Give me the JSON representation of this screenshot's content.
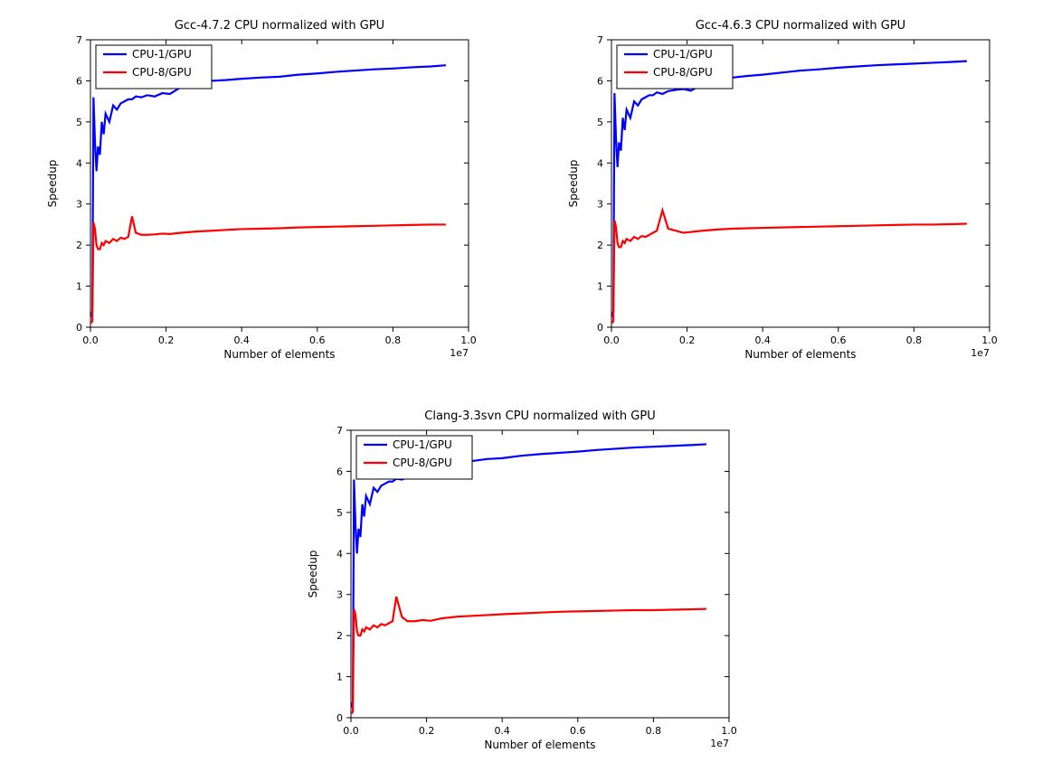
{
  "chart_data": [
    {
      "type": "line",
      "title": "Gcc-4.7.2 CPU normalized with GPU",
      "xlabel": "Number of elements",
      "ylabel": "Speedup",
      "xlim": [
        0,
        1.0
      ],
      "ylim": [
        0,
        7
      ],
      "x_exponent": "1e7",
      "xticks": [
        0.0,
        0.2,
        0.4,
        0.6,
        0.8,
        1.0
      ],
      "yticks": [
        0,
        1,
        2,
        3,
        4,
        5,
        6,
        7
      ],
      "legend_position": "upper-left",
      "series": [
        {
          "name": "CPU-1/GPU",
          "color": "#0000ff",
          "x": [
            0.002,
            0.005,
            0.008,
            0.012,
            0.016,
            0.02,
            0.025,
            0.03,
            0.035,
            0.04,
            0.05,
            0.06,
            0.07,
            0.08,
            0.09,
            0.1,
            0.11,
            0.12,
            0.135,
            0.15,
            0.17,
            0.19,
            0.21,
            0.24,
            0.28,
            0.32,
            0.36,
            0.4,
            0.45,
            0.5,
            0.55,
            0.6,
            0.65,
            0.7,
            0.75,
            0.8,
            0.85,
            0.9,
            0.94
          ],
          "y": [
            0.25,
            0.4,
            5.6,
            4.5,
            3.8,
            4.4,
            4.2,
            5.0,
            4.7,
            5.2,
            5.0,
            5.4,
            5.3,
            5.45,
            5.5,
            5.55,
            5.55,
            5.62,
            5.6,
            5.65,
            5.62,
            5.7,
            5.68,
            5.85,
            5.95,
            6.0,
            6.02,
            6.05,
            6.08,
            6.1,
            6.15,
            6.18,
            6.22,
            6.25,
            6.28,
            6.3,
            6.33,
            6.35,
            6.38
          ]
        },
        {
          "name": "CPU-8/GPU",
          "color": "#ff0000",
          "x": [
            0.002,
            0.005,
            0.008,
            0.012,
            0.016,
            0.02,
            0.025,
            0.03,
            0.035,
            0.04,
            0.05,
            0.06,
            0.07,
            0.08,
            0.09,
            0.1,
            0.11,
            0.12,
            0.135,
            0.15,
            0.17,
            0.19,
            0.21,
            0.24,
            0.28,
            0.32,
            0.36,
            0.4,
            0.45,
            0.5,
            0.55,
            0.6,
            0.65,
            0.7,
            0.75,
            0.8,
            0.85,
            0.9,
            0.94
          ],
          "y": [
            0.1,
            0.15,
            2.55,
            2.4,
            2.0,
            1.9,
            1.9,
            2.05,
            2.0,
            2.1,
            2.05,
            2.15,
            2.1,
            2.18,
            2.15,
            2.2,
            2.7,
            2.3,
            2.25,
            2.25,
            2.26,
            2.28,
            2.27,
            2.3,
            2.33,
            2.35,
            2.37,
            2.39,
            2.4,
            2.41,
            2.43,
            2.44,
            2.45,
            2.46,
            2.47,
            2.48,
            2.49,
            2.5,
            2.5
          ]
        }
      ]
    },
    {
      "type": "line",
      "title": "Gcc-4.6.3 CPU normalized with GPU",
      "xlabel": "Number of elements",
      "ylabel": "Speedup",
      "xlim": [
        0,
        1.0
      ],
      "ylim": [
        0,
        7
      ],
      "x_exponent": "1e7",
      "xticks": [
        0.0,
        0.2,
        0.4,
        0.6,
        0.8,
        1.0
      ],
      "yticks": [
        0,
        1,
        2,
        3,
        4,
        5,
        6,
        7
      ],
      "legend_position": "upper-left",
      "series": [
        {
          "name": "CPU-1/GPU",
          "color": "#0000ff",
          "x": [
            0.002,
            0.005,
            0.008,
            0.012,
            0.016,
            0.02,
            0.025,
            0.03,
            0.035,
            0.04,
            0.05,
            0.06,
            0.07,
            0.08,
            0.09,
            0.1,
            0.11,
            0.12,
            0.135,
            0.15,
            0.17,
            0.19,
            0.21,
            0.24,
            0.28,
            0.32,
            0.36,
            0.4,
            0.45,
            0.5,
            0.55,
            0.6,
            0.65,
            0.7,
            0.75,
            0.8,
            0.85,
            0.9,
            0.94
          ],
          "y": [
            0.25,
            0.4,
            5.7,
            4.6,
            3.9,
            4.5,
            4.3,
            5.1,
            4.8,
            5.3,
            5.1,
            5.5,
            5.4,
            5.55,
            5.6,
            5.65,
            5.65,
            5.72,
            5.68,
            5.75,
            5.78,
            5.8,
            5.76,
            5.92,
            6.02,
            6.08,
            6.12,
            6.15,
            6.2,
            6.25,
            6.28,
            6.32,
            6.35,
            6.38,
            6.4,
            6.42,
            6.44,
            6.46,
            6.48
          ]
        },
        {
          "name": "CPU-8/GPU",
          "color": "#ff0000",
          "x": [
            0.002,
            0.005,
            0.008,
            0.012,
            0.016,
            0.02,
            0.025,
            0.03,
            0.035,
            0.04,
            0.05,
            0.06,
            0.07,
            0.08,
            0.09,
            0.1,
            0.11,
            0.12,
            0.135,
            0.15,
            0.17,
            0.19,
            0.21,
            0.24,
            0.28,
            0.32,
            0.36,
            0.4,
            0.45,
            0.5,
            0.55,
            0.6,
            0.65,
            0.7,
            0.75,
            0.8,
            0.85,
            0.9,
            0.94
          ],
          "y": [
            0.1,
            0.15,
            2.6,
            2.45,
            2.05,
            1.95,
            1.95,
            2.1,
            2.05,
            2.15,
            2.1,
            2.2,
            2.15,
            2.22,
            2.2,
            2.25,
            2.3,
            2.35,
            2.85,
            2.4,
            2.35,
            2.3,
            2.32,
            2.35,
            2.38,
            2.4,
            2.41,
            2.42,
            2.43,
            2.44,
            2.45,
            2.46,
            2.47,
            2.48,
            2.49,
            2.5,
            2.5,
            2.51,
            2.52
          ]
        }
      ]
    },
    {
      "type": "line",
      "title": "Clang-3.3svn CPU normalized with GPU",
      "xlabel": "Number of elements",
      "ylabel": "Speedup",
      "xlim": [
        0,
        1.0
      ],
      "ylim": [
        0,
        7
      ],
      "x_exponent": "1e7",
      "xticks": [
        0.0,
        0.2,
        0.4,
        0.6,
        0.8,
        1.0
      ],
      "yticks": [
        0,
        1,
        2,
        3,
        4,
        5,
        6,
        7
      ],
      "legend_position": "upper-left",
      "series": [
        {
          "name": "CPU-1/GPU",
          "color": "#0000ff",
          "x": [
            0.002,
            0.005,
            0.008,
            0.012,
            0.016,
            0.02,
            0.025,
            0.03,
            0.035,
            0.04,
            0.05,
            0.06,
            0.07,
            0.08,
            0.09,
            0.1,
            0.11,
            0.12,
            0.135,
            0.15,
            0.17,
            0.19,
            0.21,
            0.24,
            0.28,
            0.32,
            0.36,
            0.4,
            0.45,
            0.5,
            0.55,
            0.6,
            0.65,
            0.7,
            0.75,
            0.8,
            0.85,
            0.9,
            0.94
          ],
          "y": [
            0.25,
            0.4,
            5.8,
            4.7,
            4.0,
            4.6,
            4.4,
            5.2,
            4.9,
            5.4,
            5.2,
            5.6,
            5.5,
            5.65,
            5.7,
            5.75,
            5.75,
            5.82,
            5.8,
            5.85,
            5.9,
            5.92,
            5.85,
            6.1,
            6.2,
            6.25,
            6.3,
            6.32,
            6.38,
            6.42,
            6.45,
            6.48,
            6.52,
            6.55,
            6.58,
            6.6,
            6.62,
            6.64,
            6.66
          ]
        },
        {
          "name": "CPU-8/GPU",
          "color": "#ff0000",
          "x": [
            0.002,
            0.005,
            0.008,
            0.012,
            0.016,
            0.02,
            0.025,
            0.03,
            0.035,
            0.04,
            0.05,
            0.06,
            0.07,
            0.08,
            0.09,
            0.1,
            0.11,
            0.12,
            0.135,
            0.15,
            0.17,
            0.19,
            0.21,
            0.24,
            0.28,
            0.32,
            0.36,
            0.4,
            0.45,
            0.5,
            0.55,
            0.6,
            0.65,
            0.7,
            0.75,
            0.8,
            0.85,
            0.9,
            0.94
          ],
          "y": [
            0.1,
            0.15,
            2.65,
            2.5,
            2.1,
            2.0,
            2.0,
            2.15,
            2.1,
            2.2,
            2.15,
            2.25,
            2.2,
            2.28,
            2.25,
            2.3,
            2.35,
            2.95,
            2.45,
            2.35,
            2.35,
            2.38,
            2.36,
            2.42,
            2.46,
            2.48,
            2.5,
            2.52,
            2.54,
            2.56,
            2.58,
            2.59,
            2.6,
            2.61,
            2.62,
            2.62,
            2.63,
            2.64,
            2.65
          ]
        }
      ]
    }
  ]
}
